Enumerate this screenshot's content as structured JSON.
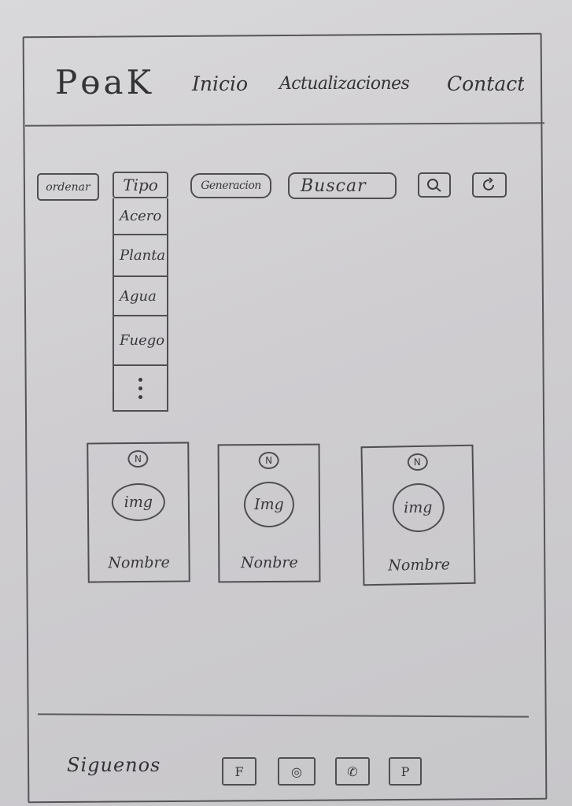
{
  "header": {
    "logo": "PɵaK",
    "nav": [
      "Inicio",
      "Actualizaciones",
      "Contacto"
    ]
  },
  "filters": {
    "ordenar": "ordenar",
    "tipo": "Tipo",
    "generacion": "Generacion",
    "search_placeholder": "Buscar",
    "search_icon": "search-icon",
    "refresh_icon": "refresh-icon"
  },
  "type_dropdown": {
    "items": [
      "Acero",
      "Planta",
      "Agua",
      "Fuego"
    ],
    "more": "⋮"
  },
  "cards": [
    {
      "badge": "N",
      "image_label": "img",
      "name": "Nombre"
    },
    {
      "badge": "N",
      "image_label": "Img",
      "name": "Nonbre"
    },
    {
      "badge": "N",
      "image_label": "img",
      "name": "Nombre"
    }
  ],
  "footer": {
    "follow_label": "Siguenos",
    "social": [
      {
        "icon": "facebook-icon",
        "label": "F"
      },
      {
        "icon": "instagram-icon",
        "label": "◎"
      },
      {
        "icon": "whatsapp-icon",
        "label": "✆"
      },
      {
        "icon": "pinterest-icon",
        "label": "P"
      }
    ]
  }
}
